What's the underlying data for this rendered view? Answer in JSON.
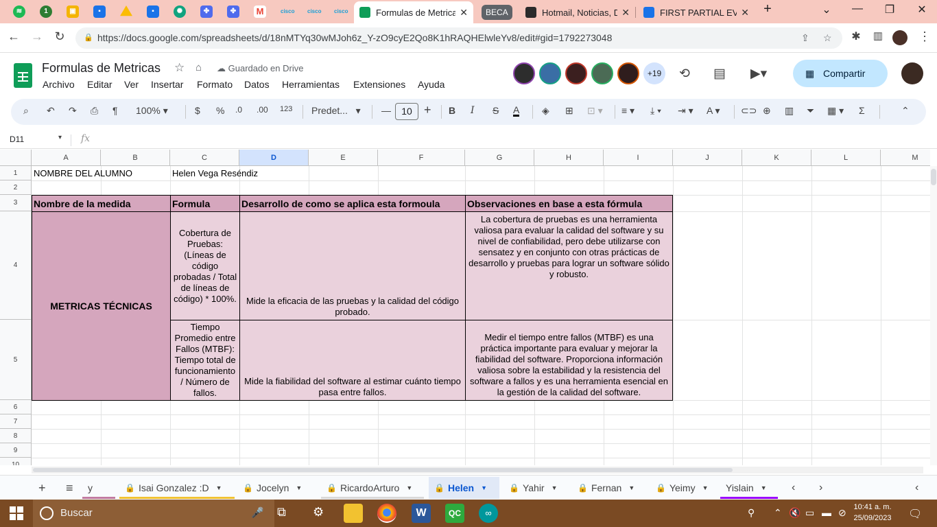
{
  "browser": {
    "tabs": [
      {
        "label": "Formulas de Metricas",
        "active": true
      },
      {
        "label": "BECA"
      },
      {
        "label": "Hotmail, Noticias, De"
      },
      {
        "label": "FIRST PARTIAL EVALU"
      }
    ],
    "url": "https://docs.google.com/spreadsheets/d/18nMTYq30wMJoh6z_Y-zO9cyE2Qo8K1hRAQHElwleYv8/edit#gid=1792273048"
  },
  "sheets": {
    "title": "Formulas de Metricas",
    "saved_status": "Guardado en Drive",
    "menu": [
      "Archivo",
      "Editar",
      "Ver",
      "Insertar",
      "Formato",
      "Datos",
      "Herramientas",
      "Extensiones",
      "Ayuda"
    ],
    "collaborators_more": "+19",
    "share_label": "Compartir",
    "toolbar": {
      "zoom": "100%",
      "currency": "$",
      "percent": "%",
      "dec_down": ".0",
      "dec_up": ".00",
      "more_formats": "123",
      "font": "Predet...",
      "font_size": "10"
    },
    "name_box": "D11",
    "fx": "fx"
  },
  "grid": {
    "columns": [
      "A",
      "B",
      "C",
      "D",
      "E",
      "F",
      "G",
      "H",
      "I",
      "J",
      "K",
      "L",
      "M"
    ],
    "selected_column": "D",
    "rows": [
      "1",
      "2",
      "3",
      "4",
      "5",
      "6",
      "7",
      "8",
      "9",
      "10"
    ],
    "cells": {
      "a1": "NOMBRE DEL ALUMNO",
      "c1": "Helen Vega Reséndiz",
      "h_medida": "Nombre de la medida",
      "h_formula": "Formula",
      "h_desarrollo": "Desarrollo de como se aplica esta formoula",
      "h_observ": "Observaciones en base a esta fórmula",
      "metricas": "METRICAS TÉCNICAS",
      "c4": "Cobertura de Pruebas: (Líneas de código probadas / Total de líneas de código) * 100%.",
      "d4": "Mide la eficacia de las pruebas y la calidad del código probado.",
      "g4": "La cobertura de pruebas es una herramienta valiosa para evaluar la calidad del software y su nivel de confiabilidad, pero debe utilizarse con sensatez y en conjunto con otras prácticas de desarrollo y pruebas para lograr un software sólido y robusto.",
      "c5": "Tiempo Promedio entre Fallos (MTBF): Tiempo total de funcionamiento / Número de fallos.",
      "d5": "Mide la fiabilidad del software al estimar cuánto tiempo pasa entre fallos.",
      "g5": "Medir el tiempo entre fallos (MTBF) es una práctica importante para evaluar y mejorar la fiabilidad del software. Proporciona información valiosa sobre la estabilidad y la resistencia del software a fallos y es una herramienta esencial en la gestión de la calidad del software."
    }
  },
  "sheet_tabs": [
    {
      "label": "y"
    },
    {
      "label": "Isai Gonzalez :D",
      "locked": true
    },
    {
      "label": "Jocelyn",
      "locked": true
    },
    {
      "label": "RicardoArturo",
      "locked": true
    },
    {
      "label": "Helen",
      "locked": true,
      "active": true
    },
    {
      "label": "Yahir",
      "locked": true
    },
    {
      "label": "Fernan",
      "locked": true
    },
    {
      "label": "Yeimy",
      "locked": true
    },
    {
      "label": "Yislain"
    }
  ],
  "taskbar": {
    "search_placeholder": "Buscar",
    "time": "10:41 a. m.",
    "date": "25/09/2023"
  },
  "colors": {
    "header_pink": "#d5a6bd",
    "cell_pink": "#ead1dc",
    "tabstrip": "#f7c9c0",
    "taskbar": "#7a4a23"
  }
}
